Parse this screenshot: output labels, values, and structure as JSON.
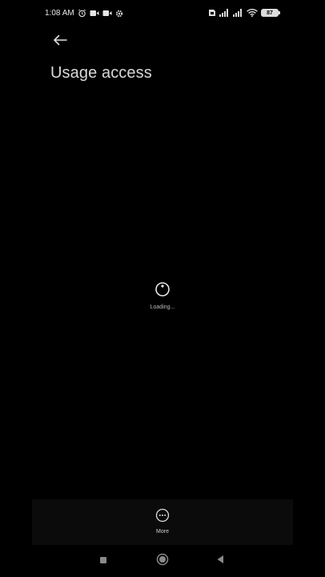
{
  "status_bar": {
    "time": "1:08 AM",
    "battery": "87",
    "icons_left": [
      "alarm-icon",
      "video-camera-icon",
      "video-camera-icon",
      "settings-gear-icon"
    ],
    "icons_right": [
      "sim-icon",
      "signal-icon",
      "signal-icon",
      "wifi-icon",
      "battery-icon"
    ]
  },
  "header": {
    "back_icon": "arrow-left-icon",
    "title": "Usage access"
  },
  "loading": {
    "icon": "loading-spinner-icon",
    "label": "Loading..."
  },
  "action_bar": {
    "more_icon": "more-dots-icon",
    "more_label": "More"
  },
  "nav_bar": {
    "buttons": [
      "recents-square-icon",
      "home-circle-icon",
      "back-triangle-icon"
    ]
  },
  "colors": {
    "background": "#000000",
    "action_bar": "#0b0b0b",
    "text": "#d8d8d8"
  }
}
